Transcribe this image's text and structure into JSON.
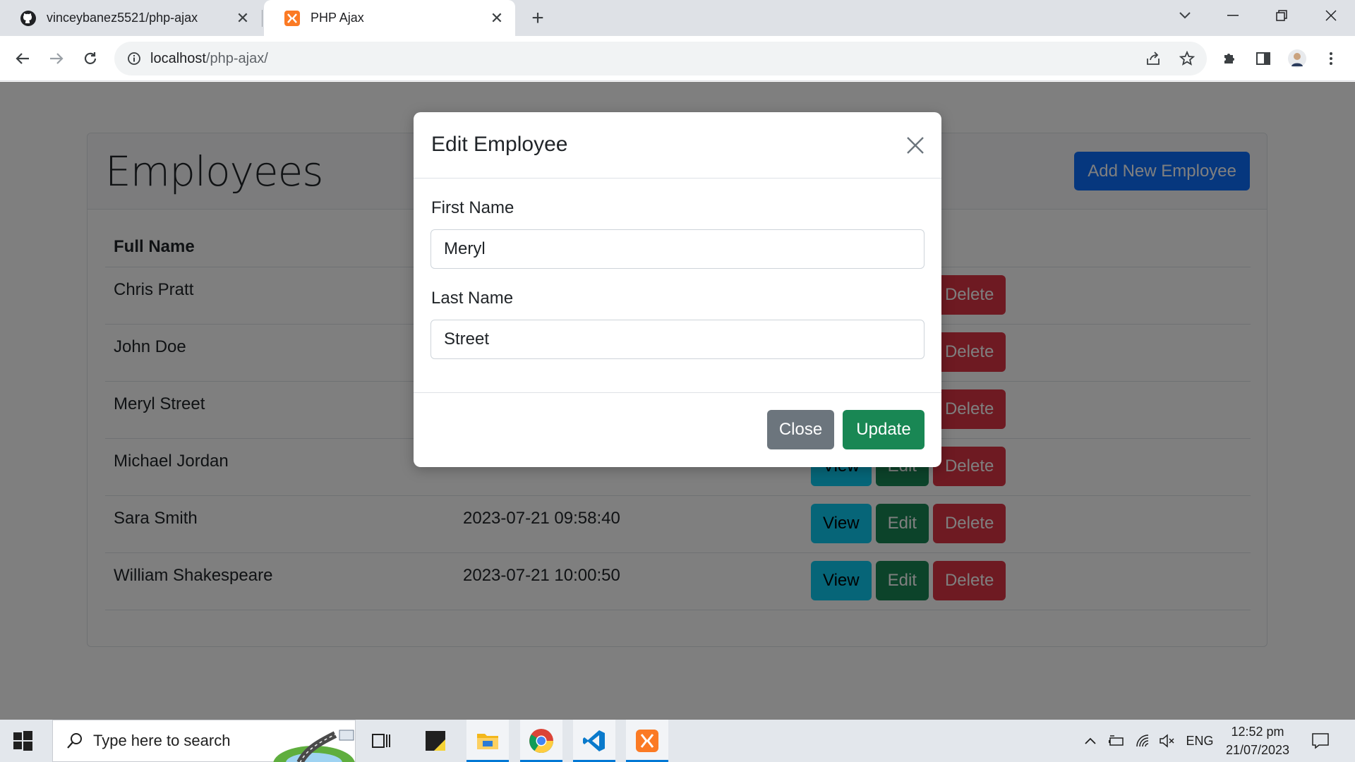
{
  "browser": {
    "tabs": [
      {
        "label": "vinceybanez5521/php-ajax",
        "icon": "github-icon",
        "active": false
      },
      {
        "label": "PHP Ajax",
        "icon": "xampp-icon",
        "active": true
      }
    ],
    "url_host": "localhost",
    "url_path": "/php-ajax/"
  },
  "page": {
    "title": "Employees",
    "add_button": "Add New Employee",
    "table": {
      "headers": [
        "Full Name"
      ],
      "rows": [
        {
          "name": "Chris Pratt",
          "date": ""
        },
        {
          "name": "John Doe",
          "date": ""
        },
        {
          "name": "Meryl Street",
          "date": ""
        },
        {
          "name": "Michael Jordan",
          "date": ""
        },
        {
          "name": "Sara Smith",
          "date": "2023-07-21 09:58:40"
        },
        {
          "name": "William Shakespeare",
          "date": "2023-07-21 10:00:50"
        }
      ],
      "actions": {
        "view": "View",
        "edit": "Edit",
        "delete": "Delete"
      }
    }
  },
  "modal": {
    "title": "Edit Employee",
    "first_name_label": "First Name",
    "first_name_value": "Meryl",
    "last_name_label": "Last Name",
    "last_name_value": "Street",
    "close_button": "Close",
    "update_button": "Update"
  },
  "taskbar": {
    "search_placeholder": "Type here to search",
    "language": "ENG",
    "time": "12:52 pm",
    "date": "21/07/2023"
  },
  "colors": {
    "primary": "#0d6efd",
    "success": "#198754",
    "danger": "#dc3545",
    "info": "#0dcaf0",
    "secondary": "#6c757d"
  }
}
